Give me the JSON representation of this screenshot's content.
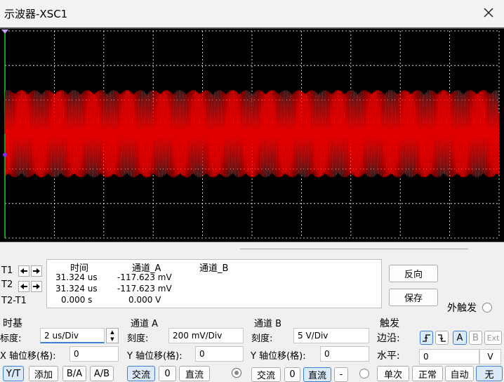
{
  "window": {
    "title": "示波器-XSC1",
    "close_icon": "close-icon"
  },
  "colors": {
    "trace": "#e00000",
    "grid": "#ffffff",
    "background": "#000000",
    "accent": "#3c7fd6"
  },
  "readout": {
    "header": {
      "time": "时间",
      "chA": "通道_A",
      "chB": "通道_B"
    },
    "rows": [
      {
        "label": "T1",
        "time": "31.324 us",
        "chA": "-117.623 mV",
        "chB": ""
      },
      {
        "label": "T2",
        "time": "31.324 us",
        "chA": "-117.623 mV",
        "chB": ""
      },
      {
        "label": "T2-T1",
        "time": "0.000 s",
        "chA": "0.000 V",
        "chB": ""
      }
    ]
  },
  "buttons": {
    "reverse": "反向",
    "save": "保存",
    "ext_trigger": "外触发"
  },
  "timebase": {
    "title": "时基",
    "scale_label": "标度:",
    "scale_value": "2 us/Div",
    "xpos_label": "X 轴位移(格):",
    "xpos_value": "0",
    "modes": [
      "Y/T",
      "添加",
      "B/A",
      "A/B"
    ]
  },
  "channel_a": {
    "title": "通道 A",
    "scale_label": "刻度:",
    "scale_value": "200 mV/Div",
    "ypos_label": "Y 轴位移(格):",
    "ypos_value": "0",
    "coupling": [
      "交流",
      "0",
      "直流"
    ]
  },
  "channel_b": {
    "title": "通道 B",
    "scale_label": "刻度:",
    "scale_value": "5  V/Div",
    "ypos_label": "Y 轴位移(格):",
    "ypos_value": "0",
    "coupling": [
      "交流",
      "0",
      "直流",
      "-"
    ]
  },
  "trigger": {
    "title": "触发",
    "edge_label": "边沿:",
    "sources": [
      "A",
      "B",
      "Ext"
    ],
    "level_label": "水平:",
    "level_value": "0",
    "level_unit": "V",
    "modes": [
      "单次",
      "正常",
      "自动",
      "无"
    ]
  }
}
